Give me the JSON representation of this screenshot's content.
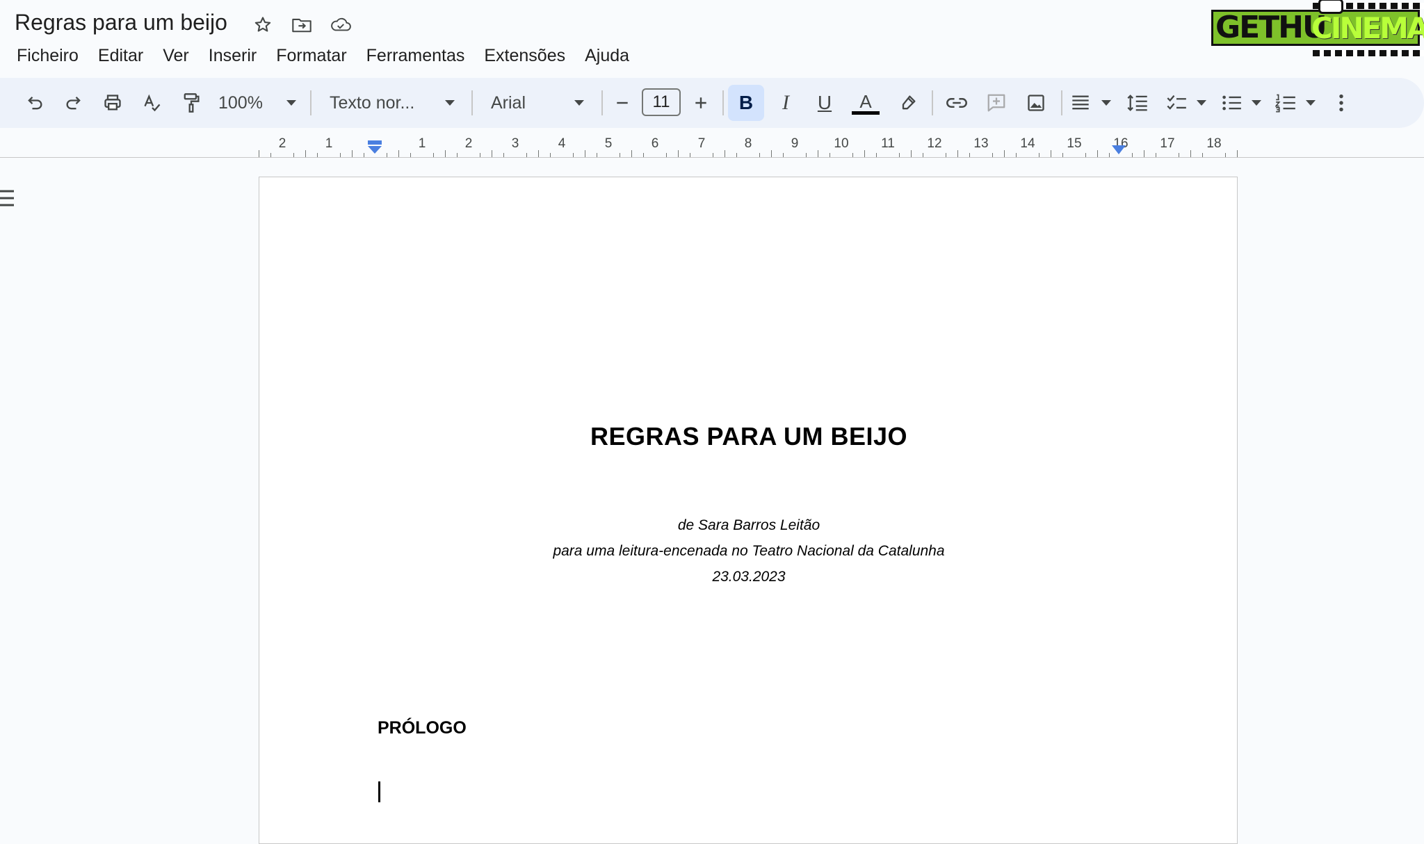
{
  "document": {
    "title": "Regras para um beijo"
  },
  "menu": [
    {
      "label": "Ficheiro"
    },
    {
      "label": "Editar"
    },
    {
      "label": "Ver"
    },
    {
      "label": "Inserir"
    },
    {
      "label": "Formatar"
    },
    {
      "label": "Ferramentas"
    },
    {
      "label": "Extensões"
    },
    {
      "label": "Ajuda"
    }
  ],
  "brand": {
    "part1": "GETHU",
    "part2": "CINEMA",
    "colors": {
      "box": "#7ec12a",
      "text": "#111111",
      "accent": "#b8ff3a"
    }
  },
  "toolbar": {
    "zoom": "100%",
    "style": "Texto nor...",
    "font": "Arial",
    "font_size": "11",
    "bold_label": "B",
    "italic_label": "I",
    "underline_label": "U",
    "text_color_label": "A",
    "bold_active_color": "#d3e3fd"
  },
  "ruler": {
    "left_labels": [
      "2",
      "1"
    ],
    "right_labels": [
      "1",
      "2",
      "3",
      "4",
      "5",
      "6",
      "7",
      "8",
      "9",
      "10",
      "11",
      "12",
      "13",
      "14",
      "15",
      "16",
      "17",
      "18"
    ]
  },
  "page": {
    "heading": "REGRAS PARA UM BEIJO",
    "byline": [
      "de Sara Barros Leitão",
      "para uma leitura-encenada no Teatro Nacional da Catalunha",
      "23.03.2023"
    ],
    "section": "PRÓLOGO"
  }
}
